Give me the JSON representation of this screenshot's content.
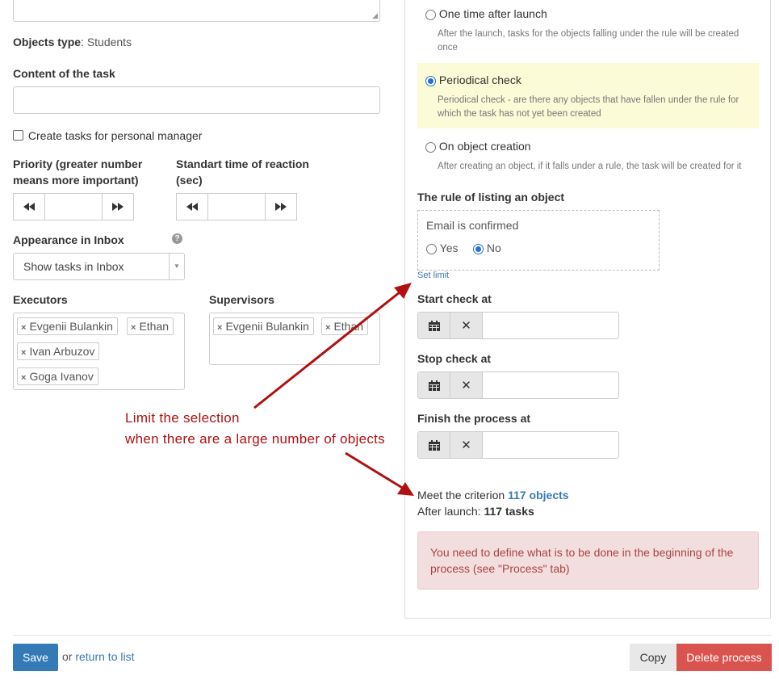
{
  "form": {
    "objects_type_label": "Objects type",
    "objects_type_value": "Students",
    "content_label": "Content of the task",
    "content_value": "",
    "personal_manager_label": "Create tasks for personal manager",
    "priority_label_1": "Priority (greater number",
    "priority_label_2": "means more important)",
    "priority_value": "",
    "reaction_label_1": "Standart time of reaction",
    "reaction_label_2": "(sec)",
    "reaction_value": "",
    "inbox_label": "Appearance in Inbox",
    "inbox_selected": "Show tasks in Inbox",
    "executors_label": "Executors",
    "executors": [
      "Evgenii Bulankin",
      "Ethan",
      "Ivan Arbuzov",
      "Goga Ivanov"
    ],
    "supervisors_label": "Supervisors",
    "supervisors": [
      "Evgenii Bulankin",
      "Ethan"
    ]
  },
  "schedule": {
    "options": [
      {
        "label": "One time after launch",
        "description_1": "After the launch, tasks for the objects falling under the rule will be created",
        "description_2": "once",
        "selected": false
      },
      {
        "label": "Periodical check",
        "description_1": "Periodical check - are there any objects that have fallen under the rule for",
        "description_2": "which the task has not yet been created",
        "selected": true
      },
      {
        "label": "On object creation",
        "description_1": "After creating an object, if it falls under a rule, the task will be created for it",
        "description_2": "",
        "selected": false
      }
    ],
    "rule_label": "The rule of listing an object",
    "rule_condition": "Email is confirmed",
    "rule_yes": "Yes",
    "rule_no": "No",
    "rule_selected": "No",
    "set_limit": "Set limit",
    "start_label": "Start check at",
    "stop_label": "Stop check at",
    "finish_label": "Finish the process at",
    "meet_prefix": "Meet the criterion",
    "meet_count": "117 objects",
    "after_prefix": "After launch:",
    "after_count": "117 tasks",
    "alert_1": "You need to define what is to be done in the beginning of the",
    "alert_2": "process (see \"Process\" tab)"
  },
  "annotation": {
    "line_1": "Limit the selection",
    "line_2": "when there are a large number of objects",
    "color": "#b01010"
  },
  "footer": {
    "save": "Save",
    "or": "or",
    "return": "return to list",
    "copy": "Copy",
    "delete": "Delete process"
  }
}
